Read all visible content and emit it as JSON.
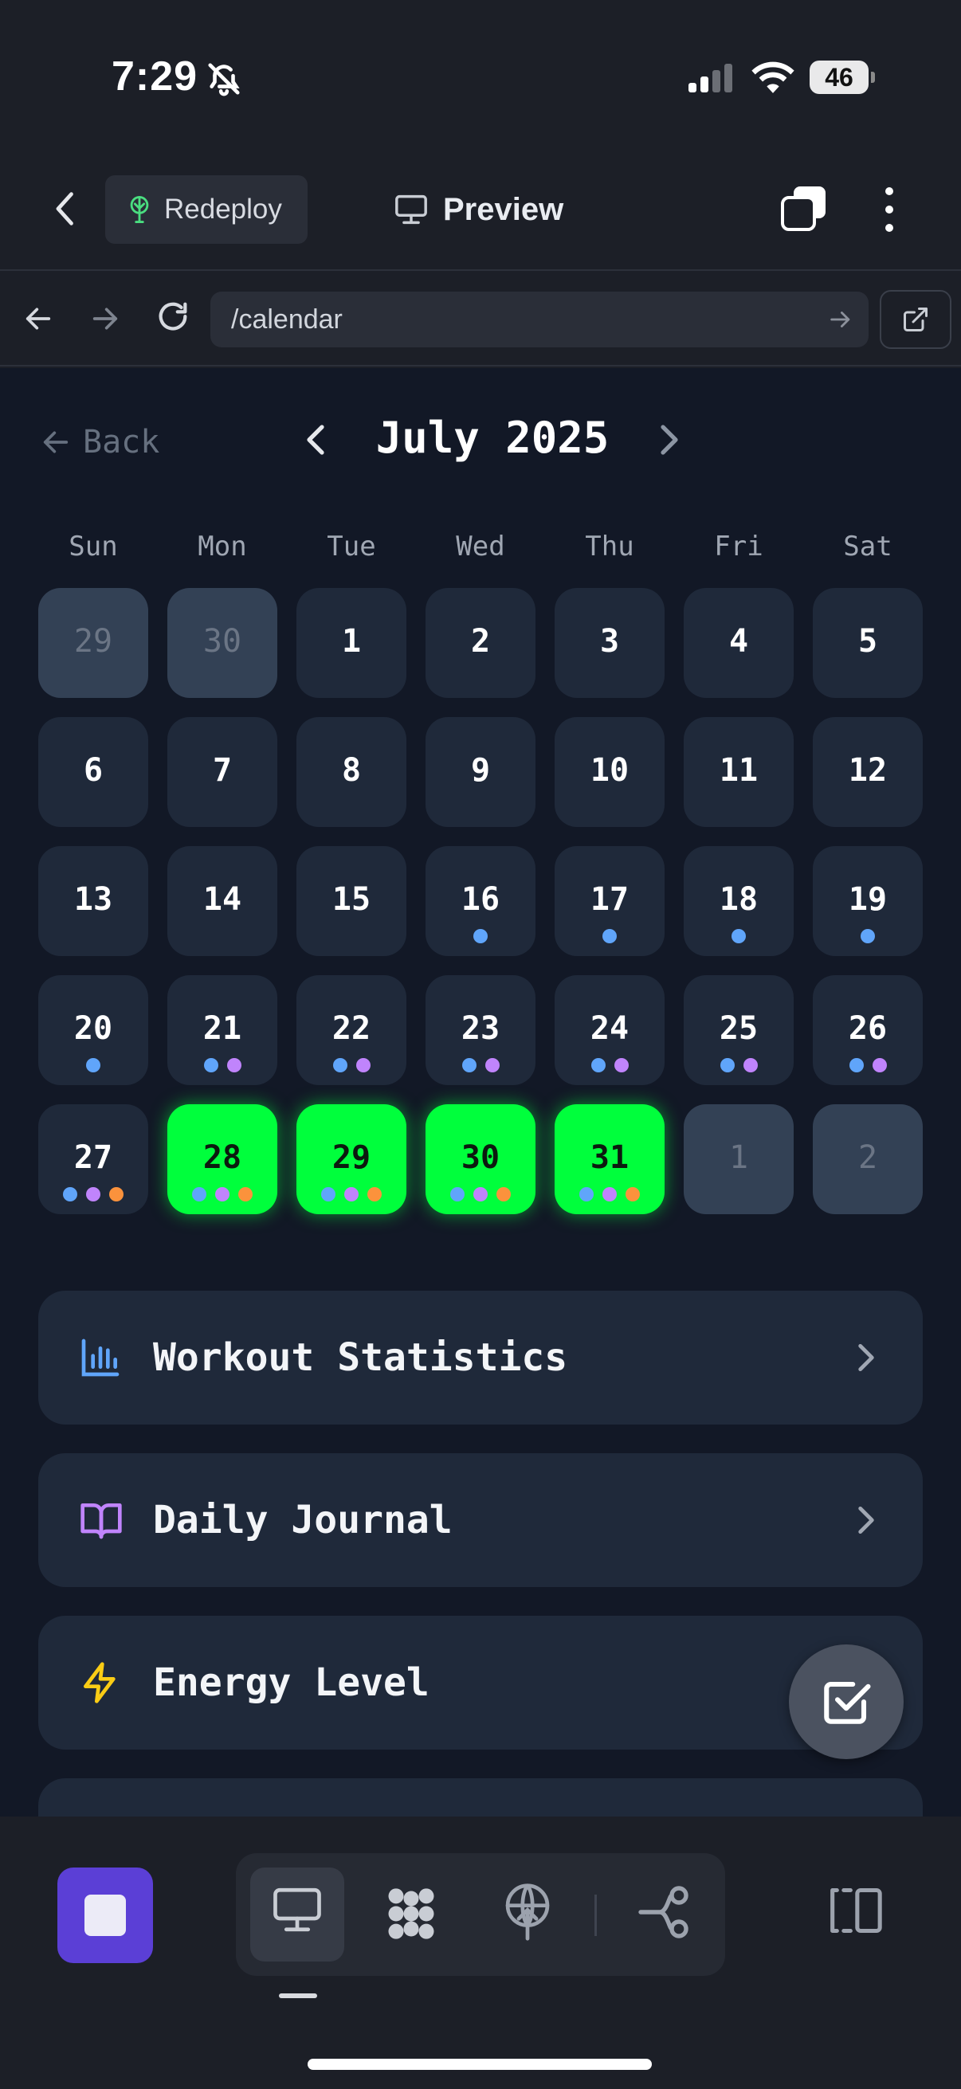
{
  "status_bar": {
    "time": "7:29",
    "battery": "46"
  },
  "header": {
    "redeploy_label": "Redeploy",
    "preview_label": "Preview"
  },
  "url_bar": {
    "path": "/calendar"
  },
  "calendar": {
    "back_label": "Back",
    "month_title": "July 2025",
    "weekdays": [
      "Sun",
      "Mon",
      "Tue",
      "Wed",
      "Thu",
      "Fri",
      "Sat"
    ],
    "weeks": [
      [
        {
          "day": "29",
          "other": true,
          "dots": []
        },
        {
          "day": "30",
          "other": true,
          "dots": []
        },
        {
          "day": "1",
          "dots": []
        },
        {
          "day": "2",
          "dots": []
        },
        {
          "day": "3",
          "dots": []
        },
        {
          "day": "4",
          "dots": []
        },
        {
          "day": "5",
          "dots": []
        }
      ],
      [
        {
          "day": "6",
          "dots": []
        },
        {
          "day": "7",
          "dots": []
        },
        {
          "day": "8",
          "dots": []
        },
        {
          "day": "9",
          "dots": []
        },
        {
          "day": "10",
          "dots": []
        },
        {
          "day": "11",
          "dots": []
        },
        {
          "day": "12",
          "dots": []
        }
      ],
      [
        {
          "day": "13",
          "dots": []
        },
        {
          "day": "14",
          "dots": []
        },
        {
          "day": "15",
          "dots": []
        },
        {
          "day": "16",
          "dots": [
            "blue"
          ]
        },
        {
          "day": "17",
          "dots": [
            "blue"
          ]
        },
        {
          "day": "18",
          "dots": [
            "blue"
          ]
        },
        {
          "day": "19",
          "dots": [
            "blue"
          ]
        }
      ],
      [
        {
          "day": "20",
          "dots": [
            "blue"
          ]
        },
        {
          "day": "21",
          "dots": [
            "blue",
            "purple"
          ]
        },
        {
          "day": "22",
          "dots": [
            "blue",
            "purple"
          ]
        },
        {
          "day": "23",
          "dots": [
            "blue",
            "purple"
          ]
        },
        {
          "day": "24",
          "dots": [
            "blue",
            "purple"
          ]
        },
        {
          "day": "25",
          "dots": [
            "blue",
            "purple"
          ]
        },
        {
          "day": "26",
          "dots": [
            "blue",
            "purple"
          ]
        }
      ],
      [
        {
          "day": "27",
          "dots": [
            "blue",
            "purple",
            "orange"
          ]
        },
        {
          "day": "28",
          "highlight": true,
          "dots": [
            "blue",
            "purple",
            "orange"
          ]
        },
        {
          "day": "29",
          "highlight": true,
          "dots": [
            "blue",
            "purple",
            "orange"
          ]
        },
        {
          "day": "30",
          "highlight": true,
          "dots": [
            "blue",
            "purple",
            "orange"
          ]
        },
        {
          "day": "31",
          "highlight": true,
          "dots": [
            "blue",
            "purple",
            "orange"
          ]
        },
        {
          "day": "1",
          "other": true,
          "dots": []
        },
        {
          "day": "2",
          "other": true,
          "dots": []
        }
      ]
    ]
  },
  "cards": [
    {
      "label": "Workout Statistics",
      "icon": "bar-chart-icon",
      "color": "#60a5fa",
      "chevron": true
    },
    {
      "label": "Daily Journal",
      "icon": "book-open-icon",
      "color": "#c084fc",
      "chevron": true
    },
    {
      "label": "Energy Level",
      "icon": "lightning-icon",
      "color": "#facc15",
      "chevron": false
    }
  ],
  "colors": {
    "highlight": "#00ff3c",
    "dot_blue": "#60a5fa",
    "dot_purple": "#c084fc",
    "dot_orange": "#fb923c",
    "stop_button": "#5b3fd6"
  },
  "toolbar": {
    "icons": [
      "stop-icon",
      "monitor-icon",
      "blocks-icon",
      "deploy-icon",
      "workflow-icon",
      "panel-toggle-icon"
    ]
  }
}
